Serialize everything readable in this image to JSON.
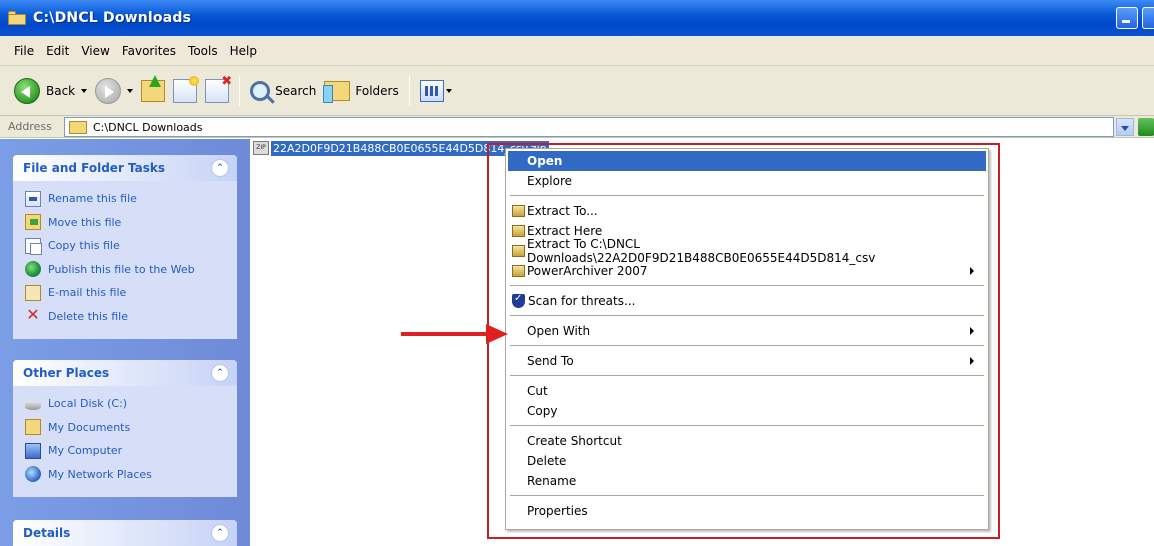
{
  "window": {
    "title": "C:\\DNCL Downloads"
  },
  "menubar": {
    "items": [
      "File",
      "Edit",
      "View",
      "Favorites",
      "Tools",
      "Help"
    ]
  },
  "toolbar": {
    "back_label": "Back",
    "search_label": "Search",
    "folders_label": "Folders"
  },
  "address": {
    "label": "Address",
    "value": "C:\\DNCL Downloads"
  },
  "sidebar": {
    "file_tasks": {
      "title": "File and Folder Tasks",
      "items": [
        {
          "label": "Rename this file",
          "icon": "rename-icon"
        },
        {
          "label": "Move this file",
          "icon": "move-icon"
        },
        {
          "label": "Copy this file",
          "icon": "copy-icon"
        },
        {
          "label": "Publish this file to the Web",
          "icon": "publish-web-icon"
        },
        {
          "label": "E-mail this file",
          "icon": "email-icon"
        },
        {
          "label": "Delete this file",
          "icon": "delete-icon"
        }
      ]
    },
    "other_places": {
      "title": "Other Places",
      "items": [
        {
          "label": "Local Disk (C:)",
          "icon": "local-disk-icon"
        },
        {
          "label": "My Documents",
          "icon": "my-documents-icon"
        },
        {
          "label": "My Computer",
          "icon": "my-computer-icon"
        },
        {
          "label": "My Network Places",
          "icon": "network-places-icon"
        }
      ]
    },
    "details": {
      "title": "Details"
    }
  },
  "file": {
    "name": "22A2D0F9D21B488CB0E0655E44D5D814_csv.zip"
  },
  "context_menu": {
    "items": {
      "open": "Open",
      "explore": "Explore",
      "extract_to": "Extract To...",
      "extract_here": "Extract Here",
      "extract_to_folder": "Extract To C:\\DNCL Downloads\\22A2D0F9D21B488CB0E0655E44D5D814_csv",
      "powerarchiver": "PowerArchiver 2007",
      "scan": "Scan for threats...",
      "open_with": "Open With",
      "send_to": "Send To",
      "cut": "Cut",
      "copy": "Copy",
      "create_shortcut": "Create Shortcut",
      "delete": "Delete",
      "rename": "Rename",
      "properties": "Properties"
    }
  },
  "colors": {
    "titlebar": "#0a55d4",
    "highlight": "#316ac5",
    "annotation": "#c31f28",
    "sidebar_bg": "#7b9ee6",
    "task_link": "#215dc6"
  }
}
